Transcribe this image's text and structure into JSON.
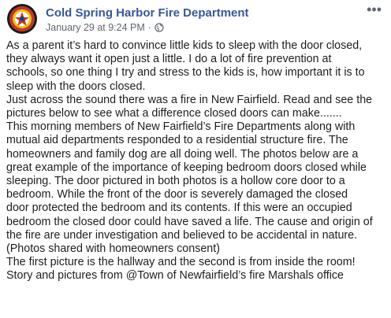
{
  "post": {
    "author": "Cold Spring Harbor Fire Department",
    "timestamp": "January 29 at 9:24 PM",
    "separator": "·",
    "privacy_icon": "globe-icon",
    "more_icon": "more-options-icon",
    "more_label": "•••",
    "avatar_icon": "fire-department-logo",
    "colors": {
      "author": "#365899",
      "meta": "#606770",
      "text": "#1c1e21"
    },
    "lines": [
      "As a parent it’s hard to convince little kids to sleep with the door closed,",
      "they always want it open just a little. I do a lot of fire prevention at",
      "schools, so one thing I try and stress to the kids is, how important it is to",
      "sleep with the doors closed.",
      "Just across the sound there was a fire in New Fairfield. Read and see the",
      "pictures below to see what a difference closed doors can make.......",
      "This morning members of New Fairfield’s Fire Departments along with",
      "mutual aid departments responded to a residential structure fire. The",
      "homeowners and family dog are all doing well. The photos below are a",
      "great example of the importance of keeping bedroom doors closed while",
      "sleeping. The door pictured in both photos is a hollow core door to a",
      "bedroom. While the front of the door is severely damaged the closed",
      "door protected the bedroom and its contents. If this were an occupied",
      "bedroom the closed door could have saved a life. The cause and origin of",
      "the fire are under investigation and believed to be accidental in nature.",
      "(Photos shared with homeowners consent)",
      "The first picture is the hallway and the second is from inside the room!",
      "Story and pictures from @Town of Newfairfield’s fire Marshals office"
    ]
  }
}
